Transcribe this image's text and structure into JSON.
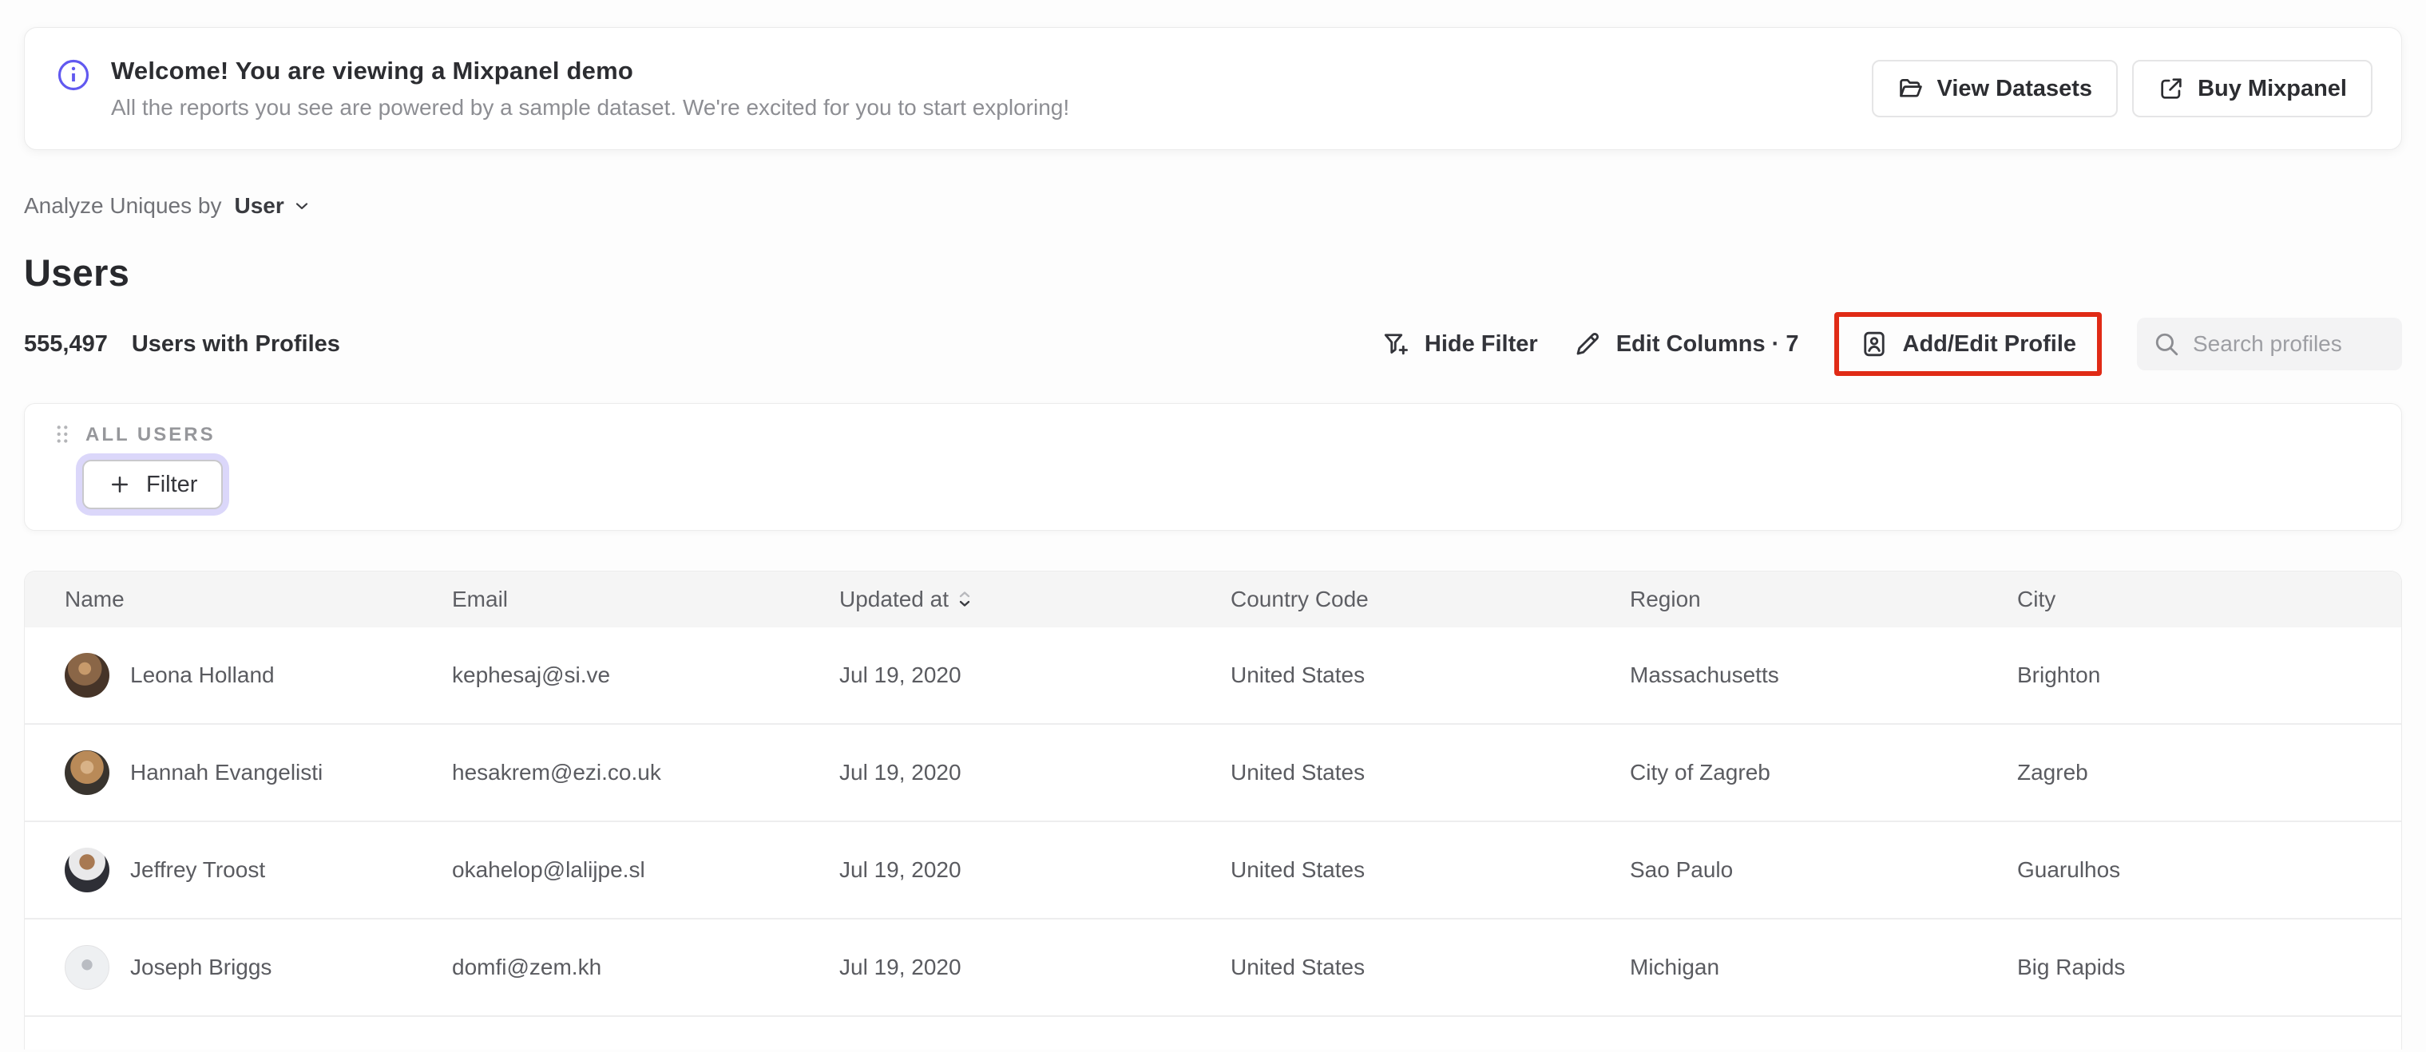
{
  "banner": {
    "title": "Welcome! You are viewing a Mixpanel demo",
    "subtitle": "All the reports you see are powered by a sample dataset. We're excited for you to start exploring!",
    "info_icon": "info-icon",
    "buttons": [
      {
        "label": "View Datasets",
        "icon": "folder-icon"
      },
      {
        "label": "Buy Mixpanel",
        "icon": "external-link-icon"
      }
    ]
  },
  "analyze": {
    "label": "Analyze Uniques by",
    "selected": "User",
    "icon": "chevron-down-icon"
  },
  "page": {
    "title": "Users",
    "count": "555,497",
    "count_label": "Users with Profiles"
  },
  "toolbar": {
    "hide_filter_label": "Hide Filter",
    "hide_filter_icon": "funnel-plus-icon",
    "edit_columns_label": "Edit Columns · 7",
    "edit_columns_icon": "pencil-icon",
    "add_edit_profile_label": "Add/Edit Profile",
    "add_edit_profile_icon": "profile-badge-icon",
    "search_placeholder": "Search profiles",
    "search_icon": "search-icon"
  },
  "filter_panel": {
    "group_label": "ALL USERS",
    "drag_icon": "drag-handle-icon",
    "add_filter_label": "Filter",
    "add_filter_icon": "plus-icon"
  },
  "table": {
    "columns": {
      "name": "Name",
      "email": "Email",
      "updated": "Updated at",
      "country": "Country Code",
      "region": "Region",
      "city": "City"
    },
    "sorted_column": "Updated at",
    "rows": [
      {
        "name": "Leona Holland",
        "email": "kephesaj@si.ve",
        "updated": "Jul 19, 2020",
        "country": "United States",
        "region": "Massachusetts",
        "city": "Brighton"
      },
      {
        "name": "Hannah Evangelisti",
        "email": "hesakrem@ezi.co.uk",
        "updated": "Jul 19, 2020",
        "country": "United States",
        "region": "City of Zagreb",
        "city": "Zagreb"
      },
      {
        "name": "Jeffrey Troost",
        "email": "okahelop@lalijpe.sl",
        "updated": "Jul 19, 2020",
        "country": "United States",
        "region": "Sao Paulo",
        "city": "Guarulhos"
      },
      {
        "name": "Joseph Briggs",
        "email": "domfi@zem.kh",
        "updated": "Jul 19, 2020",
        "country": "United States",
        "region": "Michigan",
        "city": "Big Rapids"
      }
    ]
  },
  "colors": {
    "accent_purple": "#6159f0",
    "annotation_red": "#e02b16",
    "focus_ring_lavender": "#dbd7fa",
    "header_bg": "#f5f5f5",
    "search_bg": "#f3f3f4"
  }
}
